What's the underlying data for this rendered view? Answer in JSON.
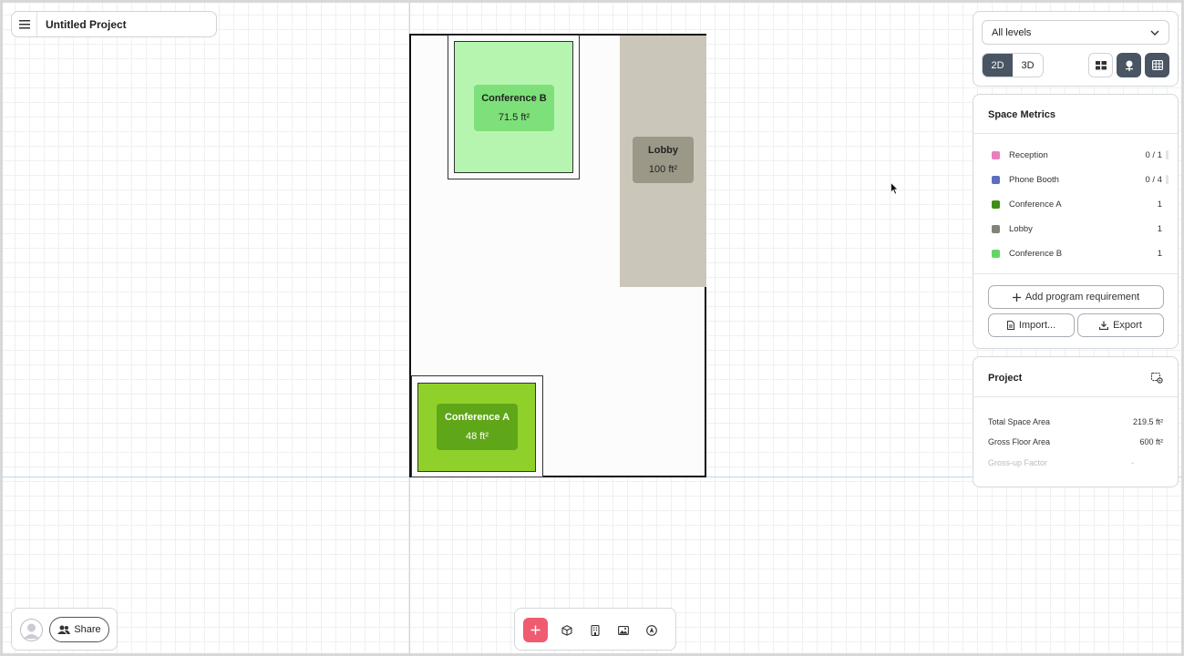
{
  "header": {
    "project_title": "Untitled Project"
  },
  "plan": {
    "rooms": [
      {
        "name": "Conference B",
        "area": "71.5 ft²",
        "fill": "#b6f5b0",
        "label_fill": "#7ee07a"
      },
      {
        "name": "Lobby",
        "area": "100 ft²",
        "fill": "#cbc6ba",
        "label_fill": "#9b9888"
      },
      {
        "name": "Conference A",
        "area": "48 ft²",
        "fill": "#8fd12a",
        "label_fill": "#5fa619",
        "label_color": "#ffffff"
      }
    ]
  },
  "view": {
    "level_select": "All levels",
    "mode_2d": "2D",
    "mode_3d": "3D"
  },
  "metrics": {
    "title": "Space Metrics",
    "items": [
      {
        "name": "Reception",
        "value": "0 / 1",
        "color": "#e87fbf",
        "bar": true
      },
      {
        "name": "Phone Booth",
        "value": "0 / 4",
        "color": "#5b6fc0",
        "bar": true
      },
      {
        "name": "Conference A",
        "value": "1",
        "color": "#3f8f16",
        "bar": false
      },
      {
        "name": "Lobby",
        "value": "1",
        "color": "#848179",
        "bar": false
      },
      {
        "name": "Conference B",
        "value": "1",
        "color": "#63d66a",
        "bar": false
      }
    ],
    "add_requirement": "Add program requirement",
    "import": "Import...",
    "export": "Export"
  },
  "project": {
    "title": "Project",
    "rows": [
      {
        "label": "Total Space Area",
        "value": "219.5 ft²"
      },
      {
        "label": "Gross Floor Area",
        "value": "600 ft²"
      },
      {
        "label": "Gross-up Factor",
        "value": "-"
      }
    ]
  },
  "footer": {
    "share": "Share"
  },
  "icons": {
    "menu": "hamburger-icon",
    "chevron": "chevron-down-icon",
    "add": "plus-icon",
    "cube": "cube-icon",
    "building": "building-icon",
    "image": "image-icon",
    "compass": "compass-icon"
  }
}
